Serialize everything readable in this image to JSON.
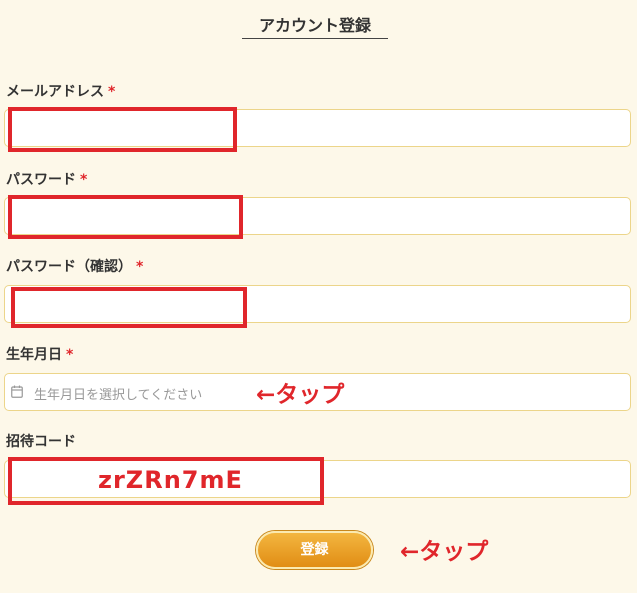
{
  "form": {
    "title": "アカウント登録",
    "email": {
      "label": "メールアドレス",
      "required_mark": "*",
      "value": ""
    },
    "password": {
      "label": "パスワード",
      "required_mark": "*",
      "value": ""
    },
    "password_confirm": {
      "label": "パスワード（確認）",
      "required_mark": "*",
      "value": ""
    },
    "birthdate": {
      "label": "生年月日",
      "required_mark": "*",
      "placeholder": "生年月日を選択してください",
      "icon": "calendar-icon"
    },
    "invite_code": {
      "label": "招待コード",
      "value": "zrZRn7mE"
    },
    "submit_label": "登録"
  },
  "annotations": {
    "tap_birthdate": "←タップ",
    "tap_submit": "←タップ",
    "highlight_color": "#e0262b"
  },
  "colors": {
    "background": "#fdf8e9",
    "field_border": "#ecd58a",
    "button": "#e8a12c",
    "required": "#e0262b"
  }
}
